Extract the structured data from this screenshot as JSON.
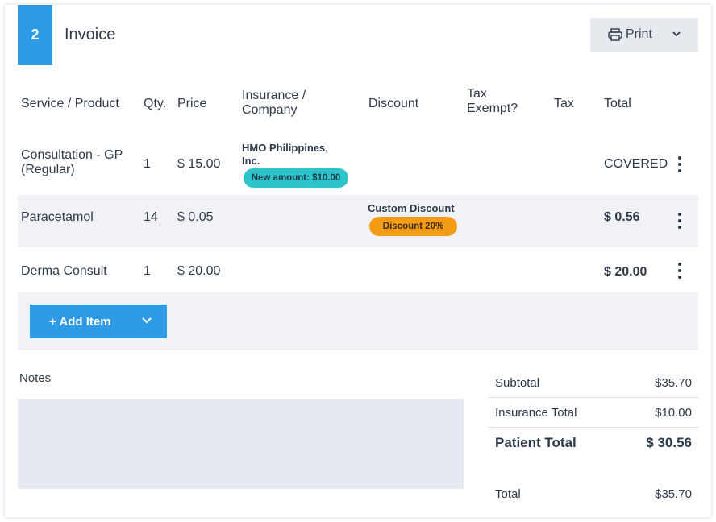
{
  "header": {
    "step": "2",
    "title": "Invoice",
    "print_label": "Print",
    "print_icon": "printer-icon"
  },
  "columns": [
    "Service / Product",
    "Qty.",
    "Price",
    "Insurance / Company",
    "Discount",
    "Tax Exempt?",
    "Tax",
    "Total"
  ],
  "columns_split": {
    "insurance_1": "Insurance /",
    "insurance_2": "Company",
    "tax_exempt_1": "Tax",
    "tax_exempt_2": "Exempt?"
  },
  "items": [
    {
      "service_1": "Consultation - GP",
      "service_2": "(Regular)",
      "qty": "1",
      "price": "$ 15.00",
      "insurance_1": "HMO Philippines,",
      "insurance_2": "Inc.",
      "insurance_badge": "New amount: $10.00",
      "total": "COVERED"
    },
    {
      "service_1": "Paracetamol",
      "qty": "14",
      "price": "$ 0.05",
      "discount_name": "Custom Discount",
      "discount_badge": "Discount 20%",
      "total": "$ 0.56"
    },
    {
      "service_1": "Derma Consult",
      "qty": "1",
      "price": "$ 20.00",
      "total": "$ 20.00"
    }
  ],
  "add_item_label": "+ Add Item",
  "notes": {
    "label": "Notes",
    "value": ""
  },
  "summary": {
    "subtotal_label": "Subtotal",
    "subtotal": "$35.70",
    "insurance_label": "Insurance Total",
    "insurance": "$10.00",
    "patient_label": "Patient Total",
    "patient": "$ 30.56",
    "total_label": "Total",
    "total": "$35.70"
  },
  "colors": {
    "accent": "#2e9be6",
    "teal_badge": "#2ec4cc",
    "orange_badge": "#f59c16",
    "row_alt": "#f0f2f6"
  }
}
